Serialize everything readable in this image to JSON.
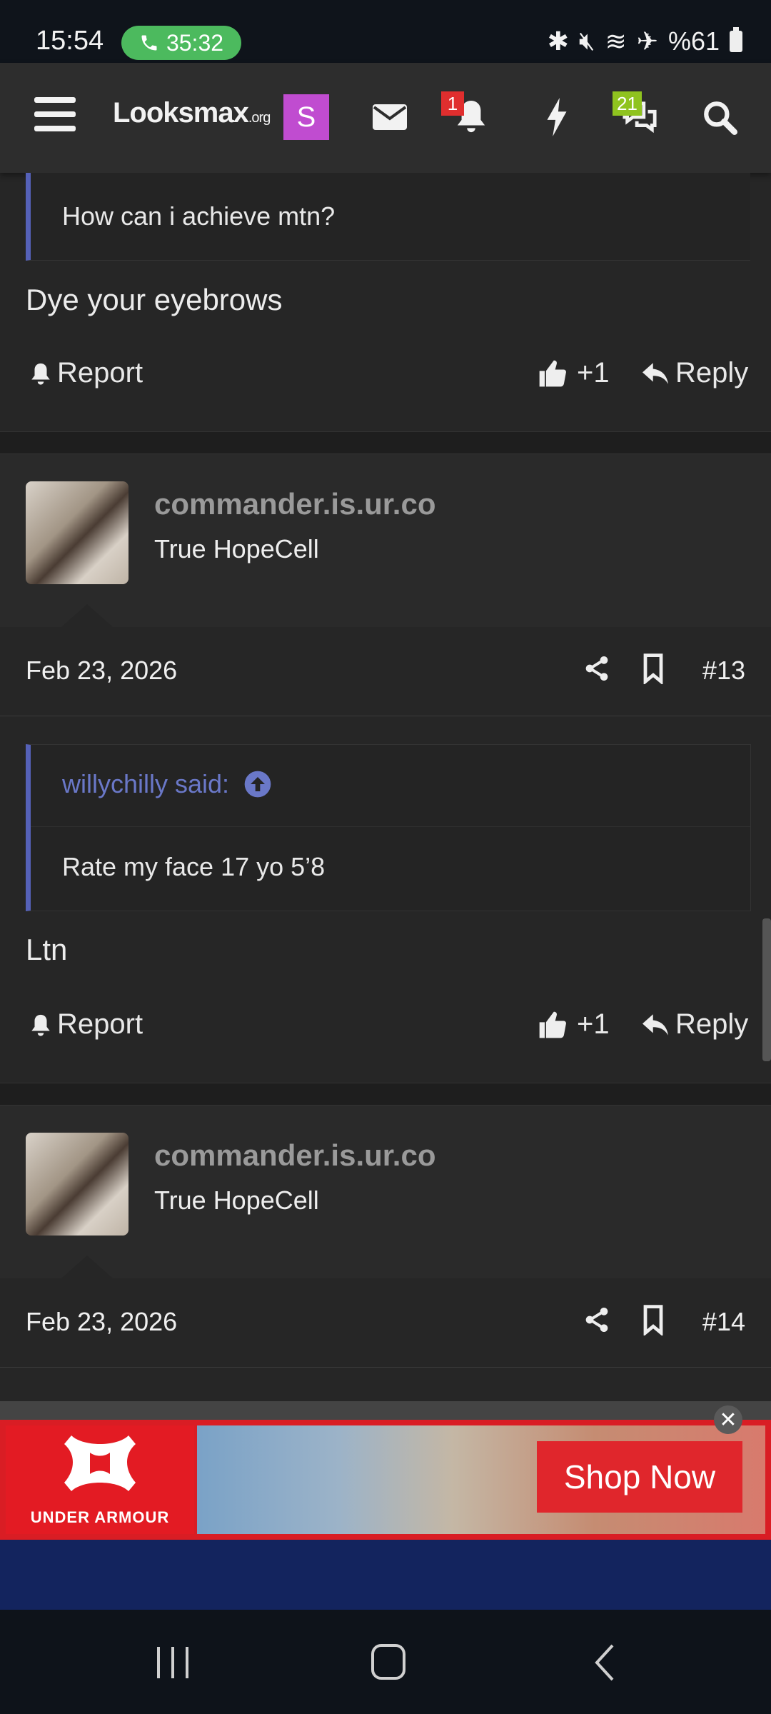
{
  "status_bar": {
    "time": "15:54",
    "call_duration": "35:32",
    "battery": "%61"
  },
  "header": {
    "logo_main": "Looksmax",
    "logo_suffix": ".org",
    "avatar_letter": "S",
    "notifications_badge": "1",
    "conversations_badge": "21"
  },
  "prev_post": {
    "quote_text": "How can i achieve mtn?",
    "body": "Dye your eyebrows",
    "report_label": "Report",
    "like_count": "+1",
    "reply_label": "Reply"
  },
  "posts": [
    {
      "username": "commander.is.ur.co",
      "user_title": "True HopeCell",
      "date": "Feb 23, 2026",
      "number": "#13",
      "quote_author": "willychilly said:",
      "quote_text": "Rate my face 17 yo 5’8",
      "body": "Ltn",
      "report_label": "Report",
      "like_count": "+1",
      "reply_label": "Reply"
    },
    {
      "username": "commander.is.ur.co",
      "user_title": "True HopeCell",
      "date": "Feb 23, 2026",
      "number": "#14"
    }
  ],
  "ad": {
    "brand": "UNDER ARMOUR",
    "cta": "Shop Now",
    "close": "✕"
  },
  "colors": {
    "quote_accent": "#5561b8",
    "call_green": "#4cba5e",
    "badge_red": "#e02e2e",
    "badge_green": "#8fc31f",
    "ad_red": "#d91d24"
  }
}
